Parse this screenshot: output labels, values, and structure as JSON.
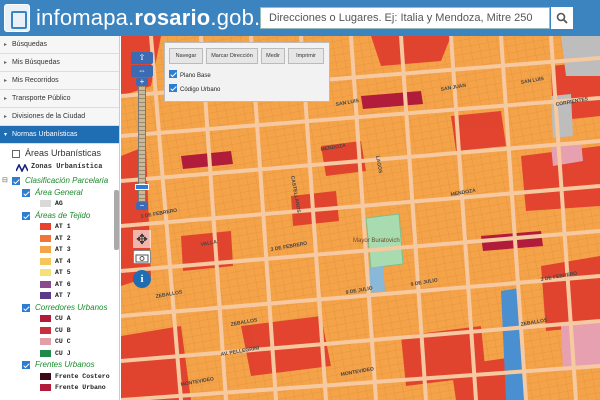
{
  "header": {
    "title_prefix": "infomapa.",
    "title_bold": "rosario",
    "title_suffix": ".gob.ar",
    "search_placeholder": "Direcciones o Lugares. Ej: Italia y Mendoza, Mitre 250",
    "logo_icon": "city-logo-icon",
    "search_icon": "search-icon"
  },
  "sidebar": {
    "menu": [
      {
        "label": "Búsquedas"
      },
      {
        "label": "Mis Búsquedas"
      },
      {
        "label": "Mis Recorridos"
      },
      {
        "label": "Transporte Público"
      },
      {
        "label": "Divisiones de la Ciudad"
      },
      {
        "label": "Normas Urbanísticas"
      }
    ],
    "tree": {
      "areas_urbanisticas": "Áreas Urbanísticas",
      "zonas_urbanisticas": "Zonas Urbanística",
      "clasificacion_parcelaria": "Clasificación Parcelaria",
      "area_general": "Área General",
      "ag": "AG",
      "areas_tejido": "Áreas de Tejido",
      "at": [
        {
          "label": "AT 1",
          "color": "#e8412e"
        },
        {
          "label": "AT 2",
          "color": "#f07638"
        },
        {
          "label": "AT 3",
          "color": "#f5a548"
        },
        {
          "label": "AT 4",
          "color": "#f7c65a"
        },
        {
          "label": "AT 5",
          "color": "#f6e07a"
        },
        {
          "label": "AT 6",
          "color": "#8b4a8c"
        },
        {
          "label": "AT 7",
          "color": "#5b3a8a"
        }
      ],
      "corredores_urbanos": "Corredores Urbanos",
      "cu": [
        {
          "label": "CU A",
          "color": "#b01c3a"
        },
        {
          "label": "CU B",
          "color": "#c8303e"
        },
        {
          "label": "CU C",
          "color": "#e2a0a6"
        },
        {
          "label": "CU J",
          "color": "#1f8a4a"
        }
      ],
      "frentes_urbanos": "Frentes Urbanos",
      "frente_costero": "Frente Costero",
      "frente_urbano": "Frente Urbano"
    }
  },
  "map": {
    "buttons": [
      "Navegar",
      "Marcar Dirección",
      "Medir",
      "Imprimir"
    ],
    "layers": [
      "Plano Base",
      "Código Urbano"
    ],
    "streets": [
      "SAN LUIS",
      "SAN JUAN",
      "SAN LUIS",
      "MENDOZA",
      "MENDOZA",
      "3 DE FEBRERO",
      "3 DE FEBRERO",
      "3 DE FEBRERO",
      "9 DE JULIO",
      "9 DE JULIO",
      "ZEBALLOS",
      "ZEBALLOS",
      "ZEBALLOS",
      "MONTEVIDEO",
      "MONTEVIDEO",
      "AV. PELLEGRINI",
      "VALLA",
      "CASTELLANOS",
      "LAGOS",
      "CORRIENTES"
    ],
    "place_label": "Mayor Buratovich",
    "zoom_in": "+",
    "zoom_out": "−"
  },
  "colors": {
    "header_bg": "#3c84c0",
    "active_menu_bg": "#1f6db3",
    "map_base": "#f4a349"
  }
}
